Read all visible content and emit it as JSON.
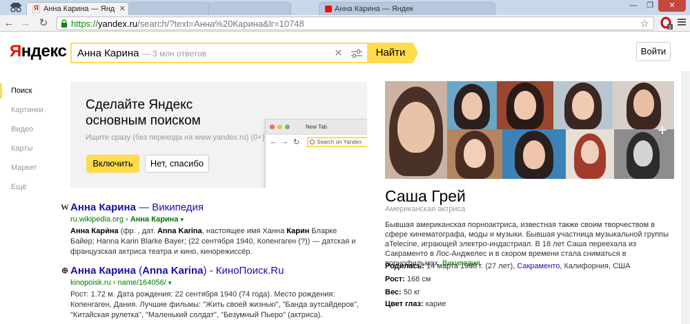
{
  "browser": {
    "active_tab_title": "Анна Карина — Яндекс: на",
    "bg_tab_title": "Анна Карина — Яндек",
    "url_scheme": "https://",
    "url_host": "yandex.ru",
    "url_rest": "/search/?text=Анна%20Карина&lr=10748"
  },
  "header": {
    "logo_first": "Я",
    "logo_rest": "ндекс",
    "query": "Анна Карина",
    "query_hint": "— 3 млн ответов",
    "search_button": "Найти",
    "login_button": "Войти"
  },
  "nav": {
    "items": [
      "Поиск",
      "Картинки",
      "Видео",
      "Карты",
      "Маркет",
      "Ещё"
    ]
  },
  "promo": {
    "title": "Сделайте Яндекс основным поиском",
    "text": "Ищите сразу (без перехода на www.yandex.ru) (0+)",
    "enable_button": "Включить",
    "decline_button": "Нет, спасибо",
    "mini_tab": "New Tab",
    "mini_search": "Search on Yandex"
  },
  "results": [
    {
      "icon": "W",
      "title_bold": "Анна Карина",
      "title_rest": " — Википедия",
      "url_plain": "ru.wikipedia.org",
      "url_sep": " › ",
      "url_bold": "Анна Карина",
      "snippet_parts": [
        {
          "b": true,
          "t": "Анна Кари́на"
        },
        {
          "b": false,
          "t": " (фр. , дат. "
        },
        {
          "b": true,
          "t": "Anna Karina"
        },
        {
          "b": false,
          "t": ", настоящее имя Ханна "
        },
        {
          "b": true,
          "t": "Карин"
        },
        {
          "b": false,
          "t": " Бларке Байер; Hanna Karin Blarke Bayer; (22 сентября 1940, Копенгаген (?)) — датская и французская актриса театра и кино, кинорежиссёр."
        }
      ]
    },
    {
      "icon": "⊕",
      "title_bold": "Анна Карина",
      "title_rest": " (",
      "title_bold2": "Anna Karina",
      "title_rest2": ") - КиноПоиск.Ru",
      "url_plain": "kinopoisk.ru",
      "url_sep": " › ",
      "url_bold": "name/164056/",
      "snippet_parts": [
        {
          "b": false,
          "t": "Рост: 1.72 м. Дата рождения: 22 сентября 1940 (74 года). Место рождения: Копенгаген, Дания. Лучшие фильмы: \"Жить своей жизнью\", \"Банда аутсайдеров\", \"Китайская рулетка\", \"Маленький солдат\", \"Безумный Пьеро\" (актриса)."
        }
      ]
    }
  ],
  "entity": {
    "name": "Саша Грей",
    "type": "Американская актриса",
    "description": "Бывшая американская порноактриса, известная также своим творчеством в сфере кинематографа, моды и музыки. Бывшая участница музыкальной группы aTelecine, играющей электро-индастриал. В 18 лет Саша переехала из Сакраменто в Лос-Анджелес и в скором времени стала сниматься в порнофильмах.",
    "description_link": "Википедия",
    "facts": {
      "born_label": "Родилась:",
      "born_value": "14 марта 1988 г. (27 лет),",
      "born_city": "Сакраменто",
      "born_rest": ", Калифорния, США",
      "height_label": "Рост:",
      "height_value": "168 см",
      "weight_label": "Вес:",
      "weight_value": "50 кг",
      "eyes_label": "Цвет глаз:",
      "eyes_value": "карие"
    }
  },
  "colors": {
    "accent": "#ffdb4d",
    "link": "#1a0dab",
    "url_green": "#007700",
    "logo_red": "#e61400"
  }
}
